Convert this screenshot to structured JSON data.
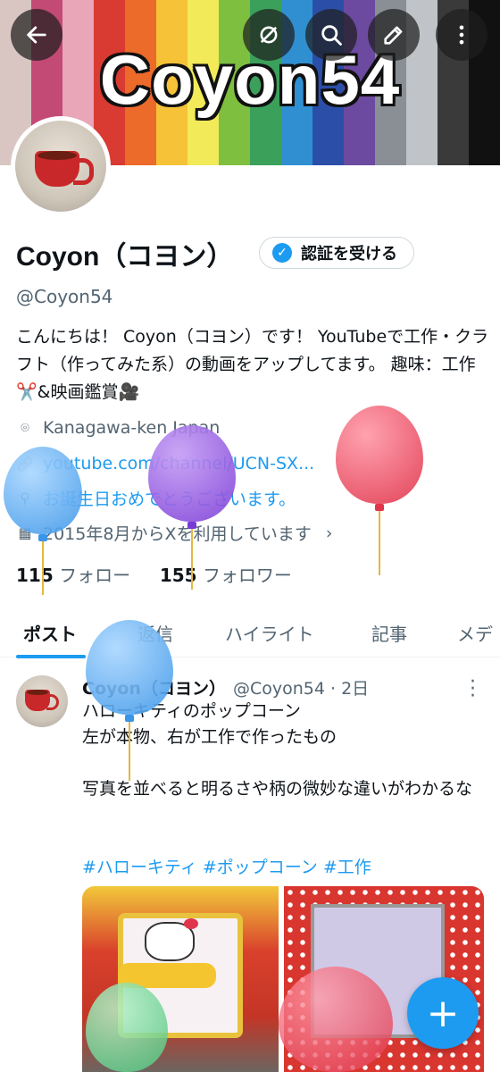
{
  "banner": {
    "title": "Coyon54",
    "stripe_colors": [
      "#d9c6c2",
      "#c24a74",
      "#e8a6b8",
      "#d93a32",
      "#ec6a2a",
      "#f5c238",
      "#f2ea59",
      "#7fbf3f",
      "#3aa05a",
      "#2f8fd1",
      "#2b4fa8",
      "#6b4aa0",
      "#8a8f96",
      "#c0c4c8",
      "#3a3a3a",
      "#111111"
    ]
  },
  "top_actions": {
    "back_icon": "arrow-left-icon",
    "grok_icon": "slashed-circle-icon",
    "search_icon": "search-icon",
    "edit_icon": "pencil-icon",
    "more_icon": "vertical-dots-icon"
  },
  "profile": {
    "display_name": "Coyon（コヨン）",
    "verify_label": "認証を受ける",
    "handle": "@Coyon54",
    "bio": "こんにちは！ Coyon（コヨン）です！ YouTubeで工作・クラフト（作ってみた系）の動画をアップしてます。 趣味：工作✂️&映画鑑賞🎥",
    "location": "Kanagawa-ken Japan",
    "website": "youtube.com/channel/UCN-SX...",
    "birthday": "お誕生日おめでとうございます。",
    "joined": "2015年8月からXを利用しています",
    "following_count": "115",
    "following_label": "フォロー",
    "followers_count": "155",
    "followers_label": "フォロワー"
  },
  "tabs": [
    "ポスト",
    "返信",
    "ハイライト",
    "記事",
    "メデ"
  ],
  "post": {
    "name": "Coyon（コヨン）",
    "meta": "@Coyon54 · 2日",
    "lines": [
      "ハローキティのポップコーン",
      "左が本物、右が工作で作ったもの",
      "",
      "写真を並べると明るさや柄の微妙な違いがわかるな"
    ],
    "hashtags": "#ハローキティ #ポップコーン #工作"
  },
  "colors": {
    "accent": "#1d9bf0",
    "text": "#0f1419",
    "muted": "#536471"
  },
  "fab_icon": "plus-icon"
}
